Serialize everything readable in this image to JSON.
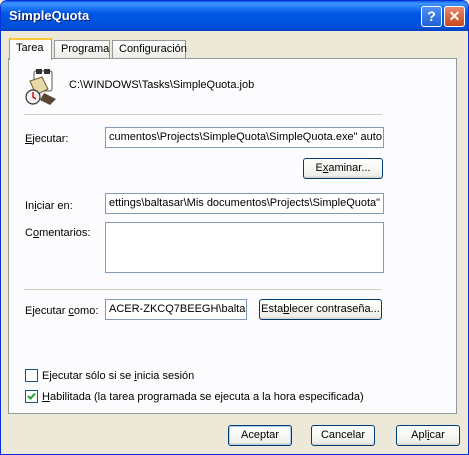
{
  "window": {
    "title": "SimpleQuota"
  },
  "title_buttons": {
    "help": "?",
    "close": "✕"
  },
  "tabs": [
    {
      "label": "Tarea",
      "active": true
    },
    {
      "label": "Programa",
      "active": false
    },
    {
      "label": "Configuración",
      "active": false
    }
  ],
  "task": {
    "file_path": "C:\\WINDOWS\\Tasks\\SimpleQuota.job",
    "icon": "scheduled-task-icon"
  },
  "fields": {
    "run_label_pre": "",
    "run_label_key": "E",
    "run_label_post": "jecutar:",
    "run_value": "cumentos\\Projects\\SimpleQuota\\SimpleQuota.exe\" auto",
    "browse_pre": "E",
    "browse_key": "x",
    "browse_post": "aminar...",
    "start_label_pre": "In",
    "start_label_key": "i",
    "start_label_post": "ciar en:",
    "start_value": "ettings\\baltasar\\Mis documentos\\Projects\\SimpleQuota\"",
    "comments_label_pre": "C",
    "comments_label_key": "o",
    "comments_label_post": "mentarios:",
    "comments_value": "",
    "runas_label_pre": "Ejecutar ",
    "runas_label_key": "c",
    "runas_label_post": "omo:",
    "runas_value": "ACER-ZKCQ7BEEGH\\balta",
    "setpwd_pre": "Esta",
    "setpwd_key": "b",
    "setpwd_post": "lecer contraseña..."
  },
  "checkboxes": {
    "only_logged_pre": "Ejecutar sólo si se ",
    "only_logged_key": "i",
    "only_logged_post": "nicia sesión",
    "only_logged_checked": false,
    "enabled_pre": "",
    "enabled_key": "H",
    "enabled_post": "abilitada (la tarea programada se ejecuta a la hora especificada)",
    "enabled_checked": true
  },
  "buttons": {
    "ok": "Aceptar",
    "cancel": "Cancelar",
    "apply_pre": "Apl",
    "apply_key": "i",
    "apply_post": "car"
  }
}
